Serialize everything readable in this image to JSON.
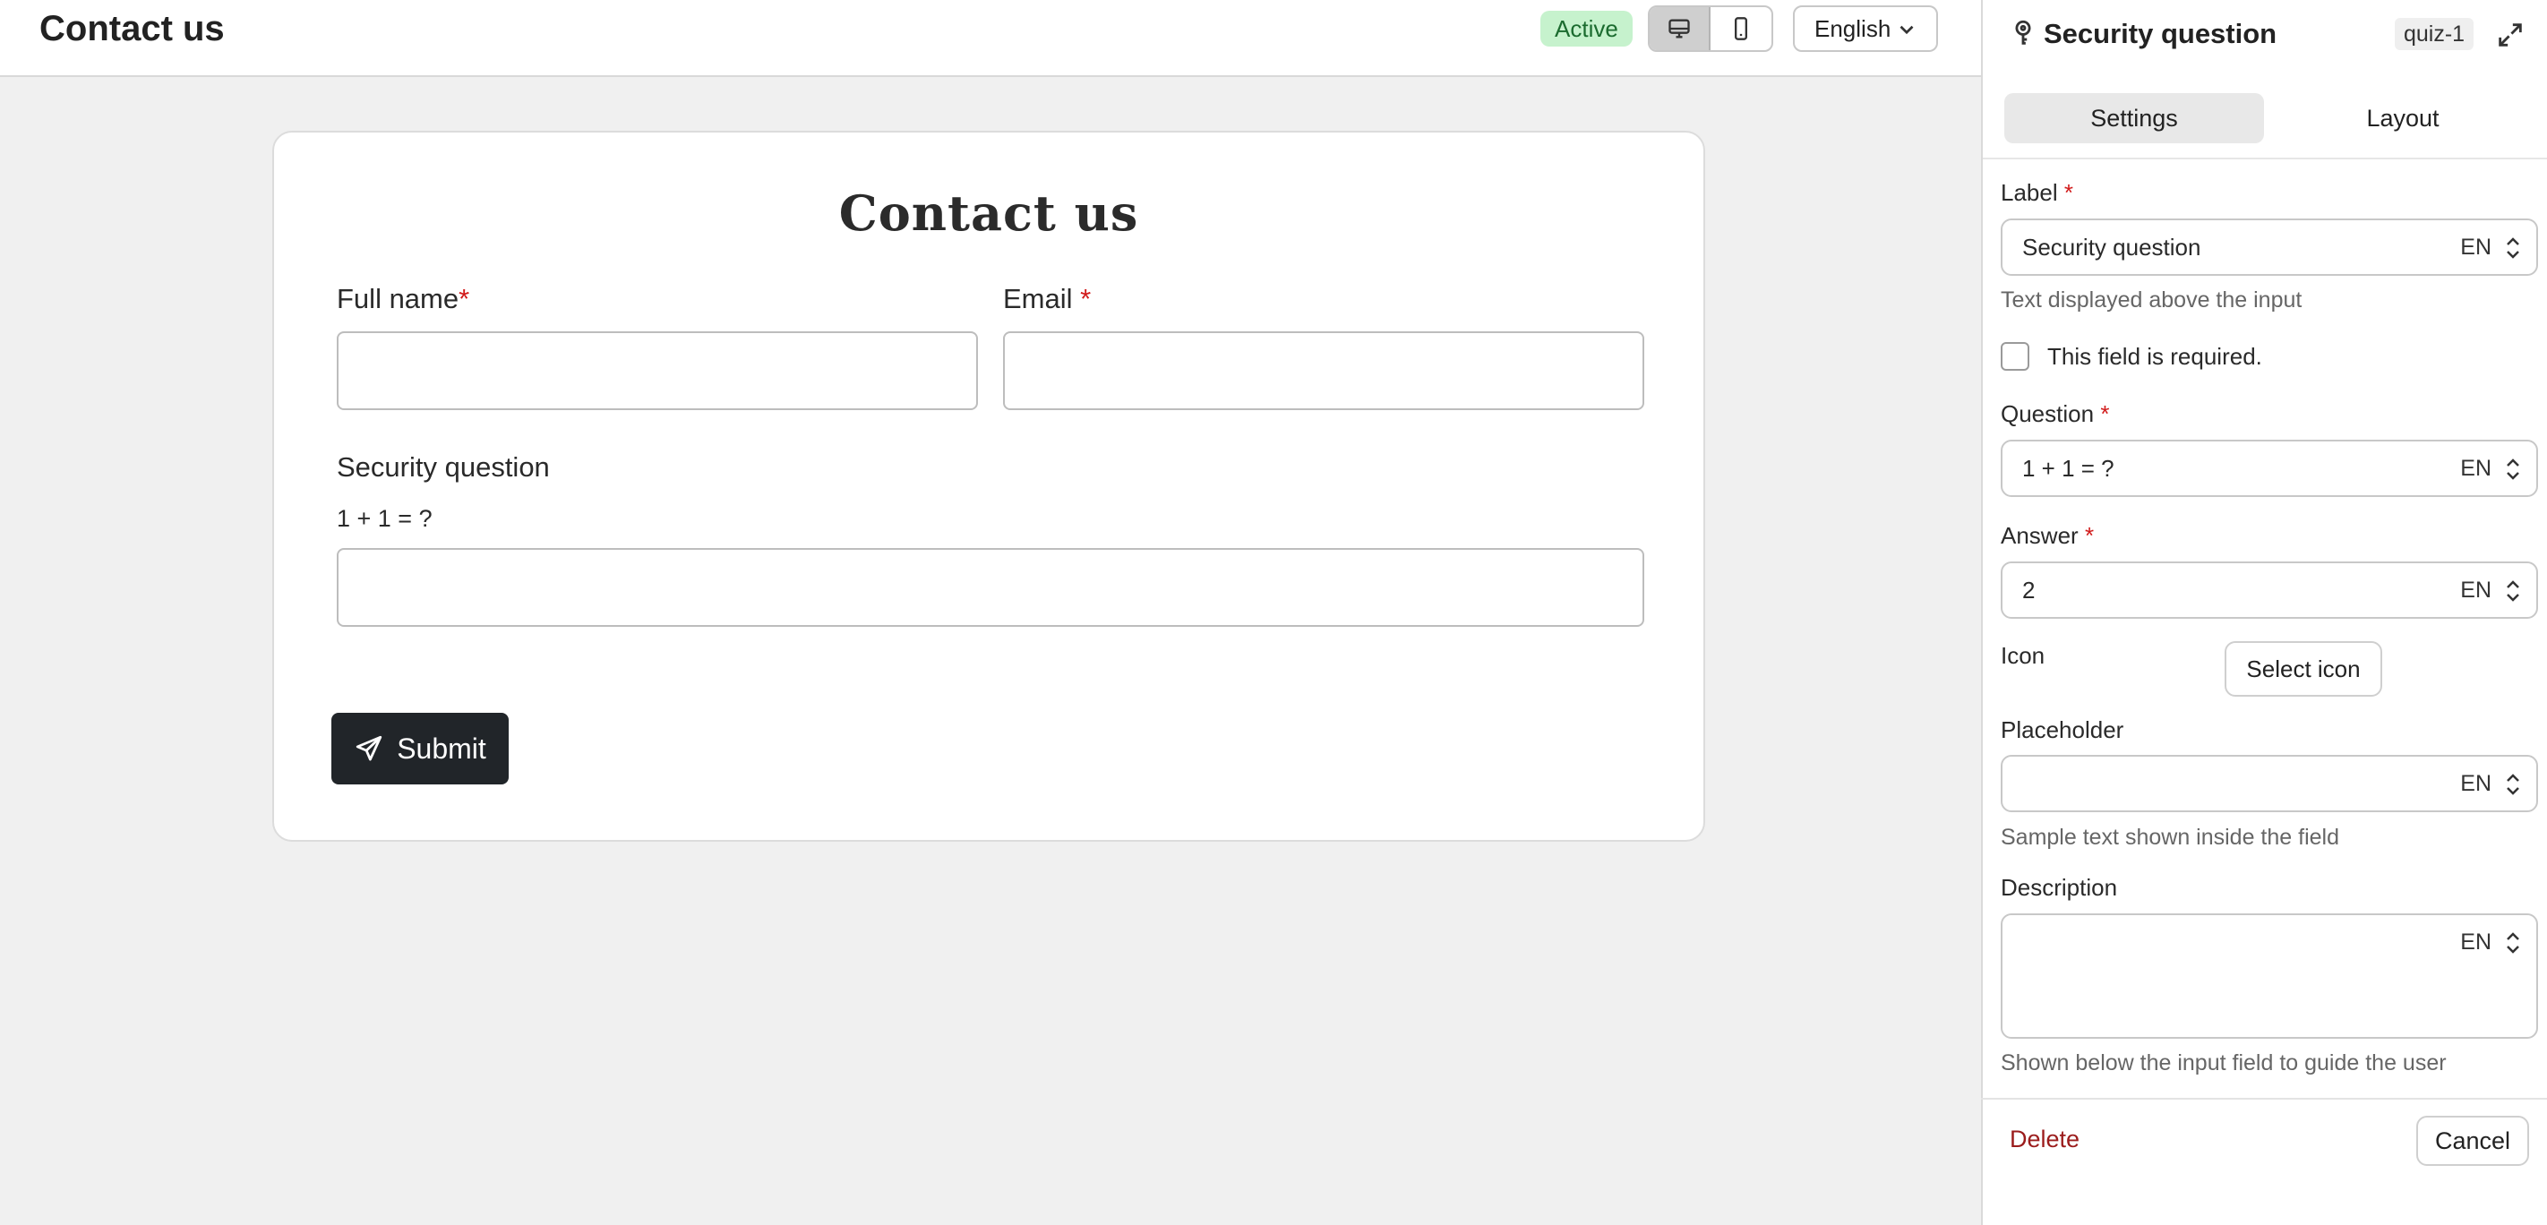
{
  "header": {
    "title": "Contact us",
    "status_badge": "Active",
    "device_toggle": {
      "desktop_icon": "desktop-icon",
      "mobile_icon": "mobile-icon",
      "selected": "desktop"
    },
    "language": "English"
  },
  "form": {
    "title": "Contact us",
    "fields": [
      {
        "label": "Full name",
        "required_mark": "*"
      },
      {
        "label": "Email",
        "required_mark": "*"
      }
    ],
    "security": {
      "label": "Security question",
      "question": "1 + 1 = ?"
    },
    "submit_label": "Submit",
    "submit_icon": "send-icon"
  },
  "panel": {
    "title": "Security question",
    "chip": "quiz-1",
    "tabs": [
      "Settings",
      "Layout"
    ],
    "active_tab": "Settings",
    "label": {
      "title": "Label",
      "value": "Security question",
      "lang": "EN",
      "help": "Text displayed above the input"
    },
    "required_checkbox": {
      "label": "This field is required.",
      "checked": false
    },
    "question": {
      "title": "Question",
      "value": "1 + 1 = ?",
      "lang": "EN"
    },
    "answer": {
      "title": "Answer",
      "value": "2",
      "lang": "EN"
    },
    "icon": {
      "title": "Icon",
      "button": "Select icon"
    },
    "placeholder": {
      "title": "Placeholder",
      "value": "",
      "lang": "EN",
      "help": "Sample text shown inside the field"
    },
    "description": {
      "title": "Description",
      "value": "",
      "lang": "EN",
      "help": "Shown below the input field to guide the user"
    },
    "required_mark": "*",
    "delete_label": "Delete",
    "cancel_label": "Cancel"
  },
  "colors": {
    "accent_dark": "#212529",
    "active_badge_bg": "#c6f2cd",
    "required": "#d11a1a",
    "delete": "#9b1c1c"
  }
}
